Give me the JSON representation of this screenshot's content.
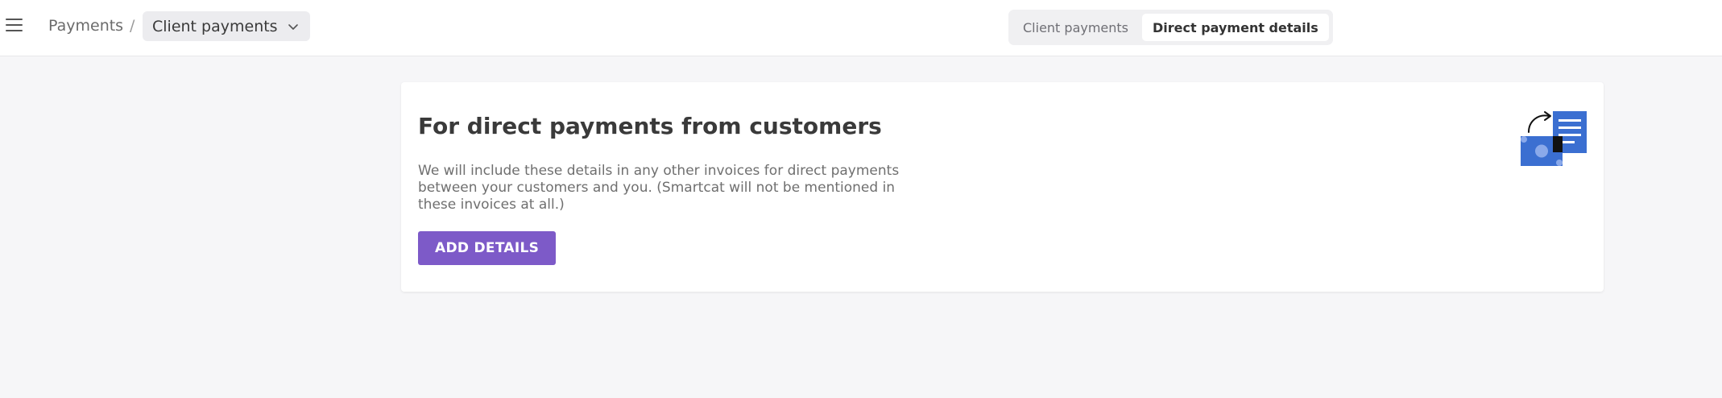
{
  "header": {
    "menu_icon": "hamburger-menu-icon",
    "breadcrumb_root": "Payments",
    "breadcrumb_separator": "/",
    "section_selector": {
      "label": "Client payments",
      "icon": "chevron-down-icon"
    },
    "tabs": [
      {
        "label": "Client payments",
        "active": false
      },
      {
        "label": "Direct payment details",
        "active": true
      }
    ]
  },
  "card": {
    "title": "For direct payments from customers",
    "description": "We will include these details in any other invoices for direct payments between your customers and you. (Smartcat will not be mentioned in these invoices at all.)",
    "button_label": "ADD DETAILS",
    "illustration_icon": "money-to-invoice-icon"
  },
  "colors": {
    "accent": "#7d5ac8",
    "illustration_blue": "#3b6fd1",
    "page_background": "#f6f6f8"
  }
}
